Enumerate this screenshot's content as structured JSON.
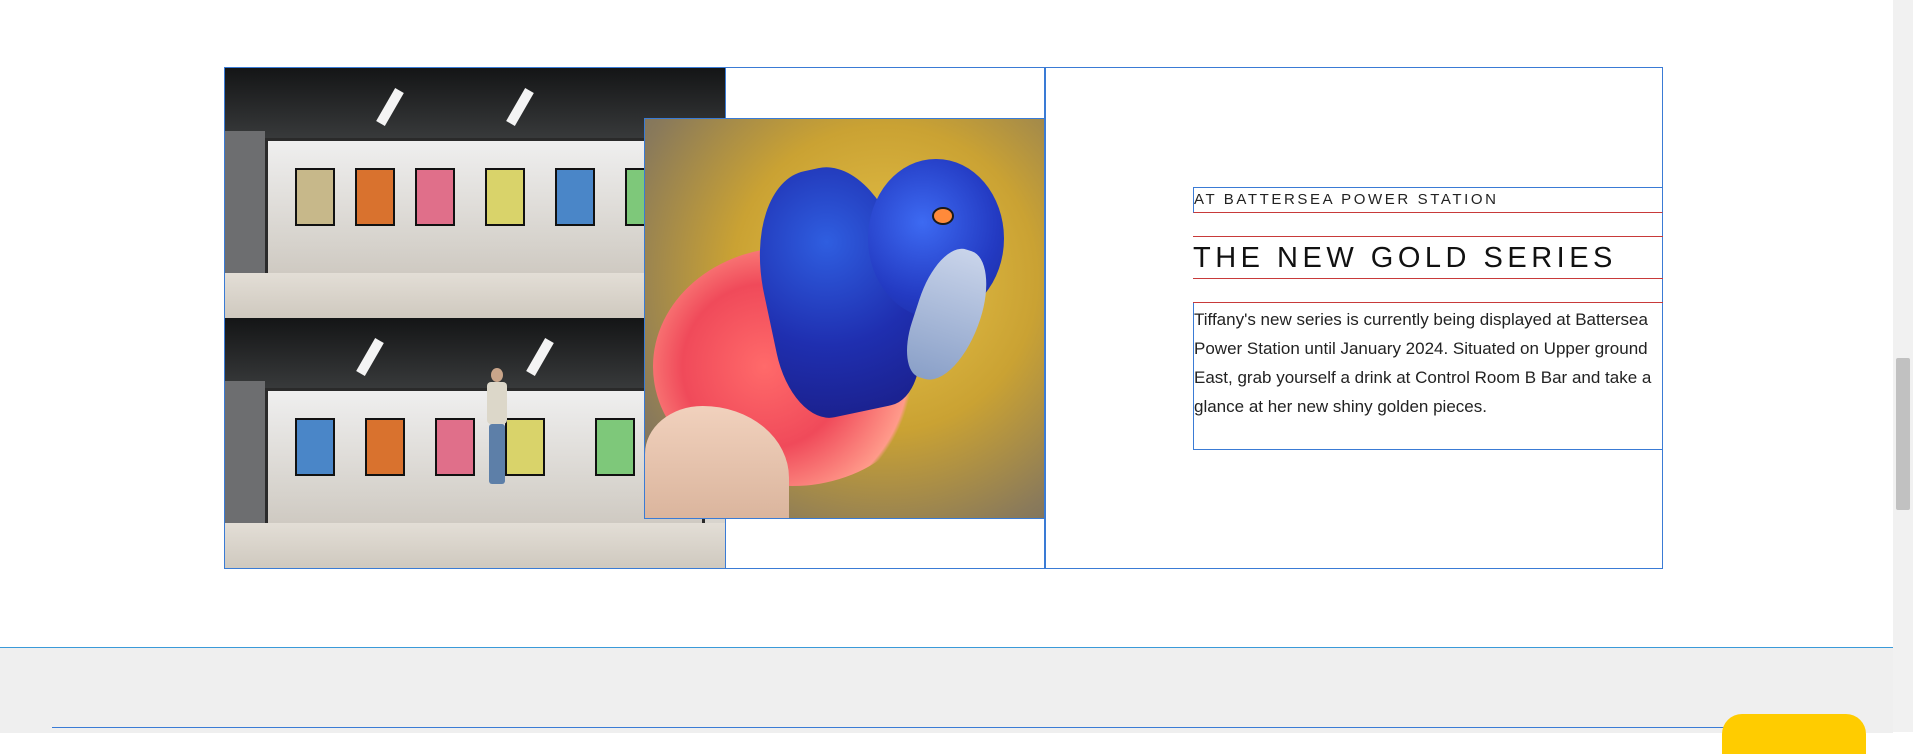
{
  "feature": {
    "eyebrow": "AT BATTERSEA POWER STATION",
    "title": "THE NEW GOLD SERIES",
    "description": "Tiffany's new series is currently being displayed at Battersea Power Station until January 2024. Situated on Upper ground East, grab yourself a drink at Control Room B Bar and take a glance at her new shiny golden pieces."
  },
  "images": {
    "gallery_photo": "exhibition-window-photo",
    "detail_photo": "peacock-painting-photo"
  },
  "colors": {
    "outline": "#3a7bd5",
    "rule": "#c83a3a",
    "footer_bg": "#efefef",
    "cta": "#ffcc00"
  }
}
